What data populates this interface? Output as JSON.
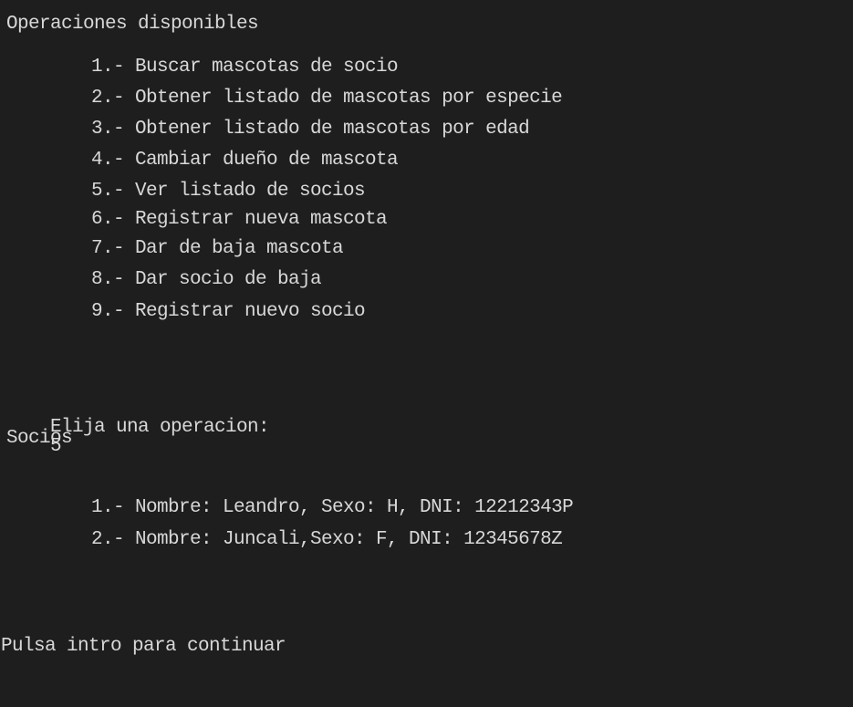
{
  "menu": {
    "title": "Operaciones disponibles",
    "items": [
      {
        "label": "1.- Buscar mascotas de socio"
      },
      {
        "label": "2.- Obtener listado de mascotas por especie"
      },
      {
        "label": "3.- Obtener listado de mascotas por edad"
      },
      {
        "label": "4.- Cambiar dueño de mascota"
      },
      {
        "label": "5.- Ver listado de socios"
      },
      {
        "label": "6.- Registrar nueva mascota"
      },
      {
        "label": "7.- Dar de baja mascota"
      },
      {
        "label": "8.- Dar socio de baja"
      },
      {
        "label": "9.- Registrar nuevo socio"
      }
    ]
  },
  "prompt": {
    "label": "Elija una operacion:",
    "value": "5"
  },
  "socios": {
    "heading": "Socios",
    "items": [
      {
        "label": "1.- Nombre: Leandro, Sexo: H, DNI: 12212343P"
      },
      {
        "label": "2.- Nombre: Juncali,Sexo: F, DNI: 12345678Z"
      }
    ]
  },
  "footer": {
    "message": "Pulsa intro para continuar"
  },
  "colors": {
    "background": "#1e1e1e",
    "text": "#d8d8d8"
  }
}
